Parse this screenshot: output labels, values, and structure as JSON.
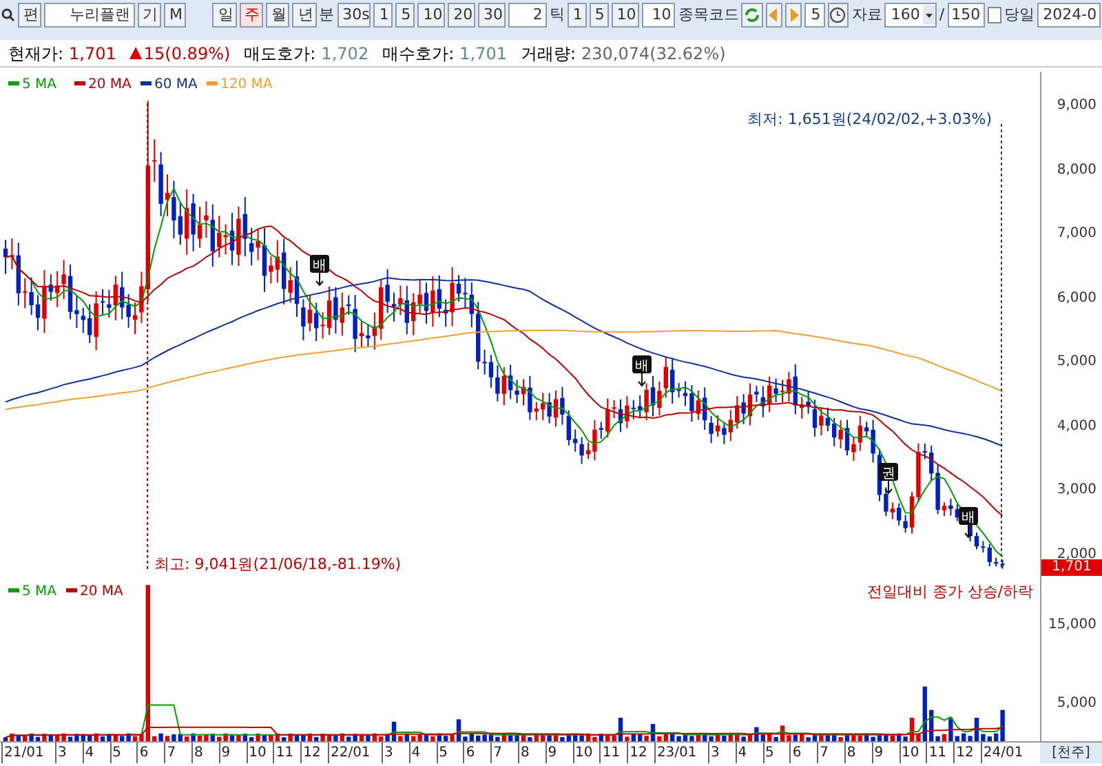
{
  "toolbar": {
    "search_button": "편",
    "stock_name": "누리플랜",
    "mode_buttons": [
      "기",
      "M"
    ],
    "periods": [
      {
        "label": "일",
        "selected": false
      },
      {
        "label": "주",
        "selected": true
      },
      {
        "label": "월",
        "selected": false
      },
      {
        "label": "년",
        "selected": false
      }
    ],
    "minute_label": "분",
    "minutes": [
      {
        "label": "30s",
        "selected": false
      },
      {
        "label": "1",
        "selected": false
      },
      {
        "label": "5",
        "selected": false
      },
      {
        "label": "10",
        "selected": false
      },
      {
        "label": "20",
        "selected": false
      },
      {
        "label": "30",
        "selected": false
      }
    ],
    "tick_count": "2",
    "tick_label": "틱",
    "ticks": [
      "1",
      "5",
      "10"
    ],
    "tick_value": "10",
    "code_label": "종목코드",
    "step": "5",
    "data_label": "자료",
    "data_count": "160",
    "slash": "/",
    "max_count": "150",
    "today": {
      "label": "당일",
      "checked": false
    },
    "date": "2024-0"
  },
  "quote": {
    "price_label": "현재가:",
    "price": "1,701",
    "change": "15(0.89%)",
    "ask_label": "매도호가:",
    "ask": "1,702",
    "bid_label": "매수호가:",
    "bid": "1,701",
    "volume_label": "거래량:",
    "volume": "230,074(32.62%)"
  },
  "price_chart": {
    "legend": [
      {
        "label": "5 MA",
        "color": "#00a000"
      },
      {
        "label": "20 MA",
        "color": "#c00000"
      },
      {
        "label": "60 MA",
        "color": "#1030a0"
      },
      {
        "label": "120 MA",
        "color": "#f0a030"
      }
    ],
    "high_note": "최고: 9,041원(21/06/18,-81.19%)",
    "low_note": "최저: 1,651원(24/02/02,+3.03%)",
    "events": [
      {
        "label": "배"
      },
      {
        "label": "배"
      },
      {
        "label": "권"
      },
      {
        "label": "배"
      }
    ],
    "axis": [
      "9,000",
      "8,000",
      "7,000",
      "6,000",
      "5,000",
      "4,000",
      "3,000",
      "2,000"
    ],
    "current_tag": "1,701"
  },
  "volume_chart": {
    "legend": [
      {
        "label": "5 MA",
        "color": "#00a000"
      },
      {
        "label": "20 MA",
        "color": "#c00000"
      }
    ],
    "note": "전일대비 종가 상승/하락",
    "axis": [
      "15,000",
      "5,000"
    ],
    "unit": "[천주]"
  },
  "x_axis": [
    {
      "label": "21/01",
      "kind": "year"
    },
    {
      "label": "3",
      "kind": "month"
    },
    {
      "label": "4",
      "kind": "month"
    },
    {
      "label": "5",
      "kind": "month"
    },
    {
      "label": "6",
      "kind": "month"
    },
    {
      "label": "7",
      "kind": "month"
    },
    {
      "label": "8",
      "kind": "month"
    },
    {
      "label": "9",
      "kind": "month"
    },
    {
      "label": "10",
      "kind": "month"
    },
    {
      "label": "11",
      "kind": "month"
    },
    {
      "label": "12",
      "kind": "month"
    },
    {
      "label": "22/01",
      "kind": "year"
    },
    {
      "label": "3",
      "kind": "month"
    },
    {
      "label": "4",
      "kind": "month"
    },
    {
      "label": "5",
      "kind": "month"
    },
    {
      "label": "6",
      "kind": "month"
    },
    {
      "label": "7",
      "kind": "month"
    },
    {
      "label": "8",
      "kind": "month"
    },
    {
      "label": "9",
      "kind": "month"
    },
    {
      "label": "10",
      "kind": "month"
    },
    {
      "label": "11",
      "kind": "month"
    },
    {
      "label": "12",
      "kind": "month"
    },
    {
      "label": "23/01",
      "kind": "year"
    },
    {
      "label": "3",
      "kind": "month"
    },
    {
      "label": "4",
      "kind": "month"
    },
    {
      "label": "5",
      "kind": "month"
    },
    {
      "label": "6",
      "kind": "month"
    },
    {
      "label": "7",
      "kind": "month"
    },
    {
      "label": "8",
      "kind": "month"
    },
    {
      "label": "9",
      "kind": "month"
    },
    {
      "label": "10",
      "kind": "month"
    },
    {
      "label": "11",
      "kind": "month"
    },
    {
      "label": "12",
      "kind": "month"
    },
    {
      "label": "24/01",
      "kind": "year"
    }
  ]
}
